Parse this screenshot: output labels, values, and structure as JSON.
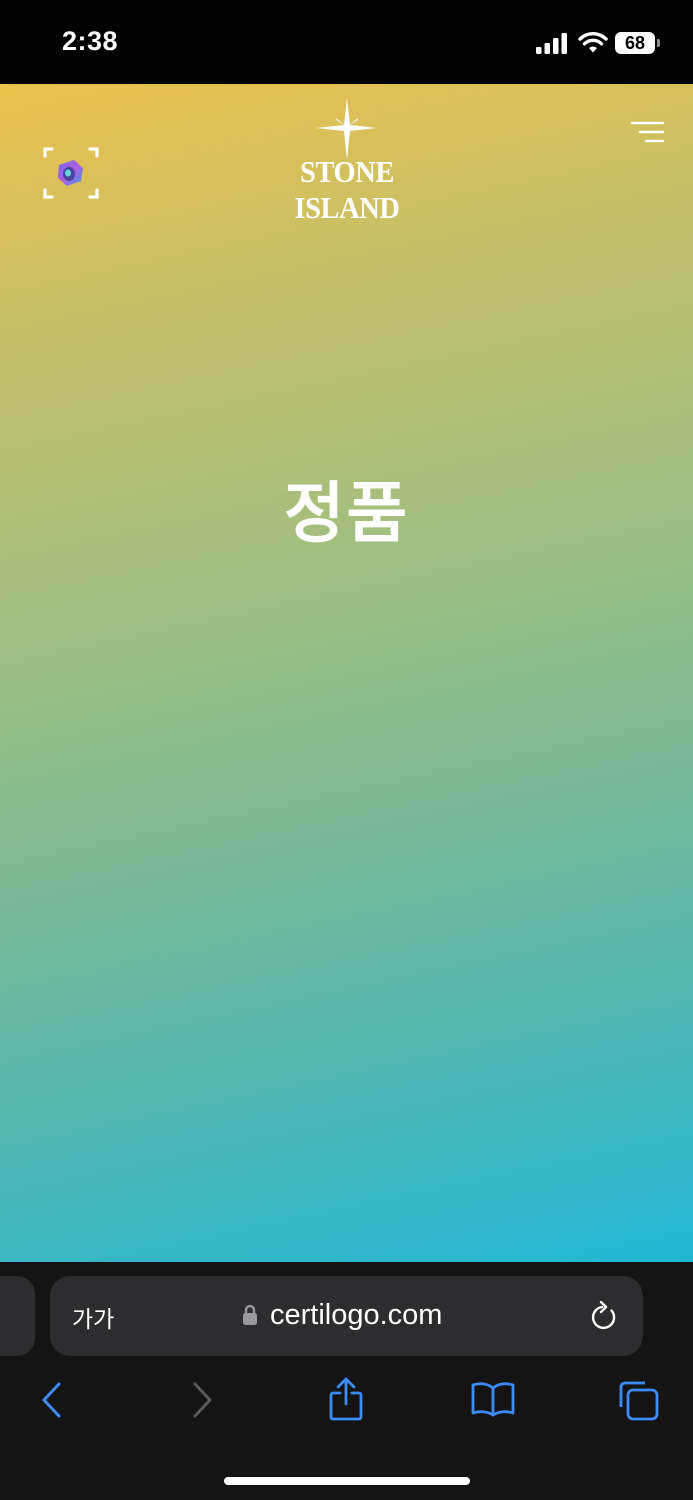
{
  "status_bar": {
    "time": "2:38",
    "battery_level": "68",
    "icons": [
      "cellular-signal-icon",
      "wifi-icon",
      "battery-icon"
    ]
  },
  "page": {
    "brand": "STONE ISLAND",
    "heading": "정품",
    "icons": [
      "scan-icon",
      "compass-star-icon",
      "menu-icon"
    ],
    "gradient_colors": [
      "#ecc14c",
      "#9ebf80",
      "#20b7d6"
    ]
  },
  "address_bar": {
    "text_size_label": "가가",
    "url": "certilogo.com",
    "icons": [
      "lock-icon",
      "reload-icon"
    ]
  },
  "toolbar": {
    "icons": [
      "back-icon",
      "forward-icon",
      "share-icon",
      "bookmarks-icon",
      "tabs-icon"
    ],
    "accent_color": "#3d8bf5",
    "disabled_color": "#5a5a5c"
  }
}
